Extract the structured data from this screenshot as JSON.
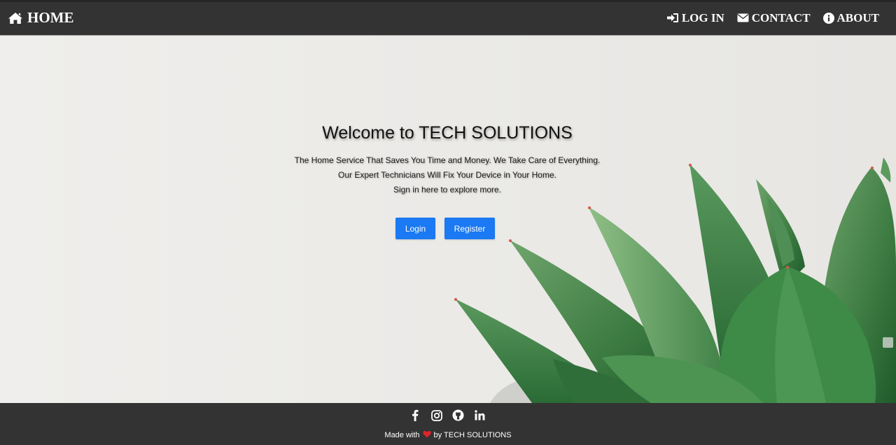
{
  "nav": {
    "home_label": "HOME",
    "login_label": "LOG IN",
    "contact_label": "CONTACT",
    "about_label": "ABOUT",
    "icons": [
      "home-icon",
      "sign-in-icon",
      "envelope-icon",
      "info-icon"
    ]
  },
  "hero": {
    "title": "Welcome to TECH SOLUTIONS",
    "line1": "The Home Service That Saves You Time and Money. We Take Care of Everything.",
    "line2": "Our Expert Technicians Will Fix Your Device in Your Home.",
    "line3": "Sign in here to explore more.",
    "login_button": "Login",
    "register_button": "Register"
  },
  "footer": {
    "social_icons": [
      "facebook-icon",
      "instagram-icon",
      "github-icon",
      "linkedin-icon"
    ],
    "made_with": "Made with",
    "by_text": "by TECH SOLUTIONS"
  },
  "colors": {
    "nav_bg": "#333333",
    "footer_bg": "#333333",
    "button_blue": "#1a79f3",
    "heart_red": "#e0242a"
  }
}
